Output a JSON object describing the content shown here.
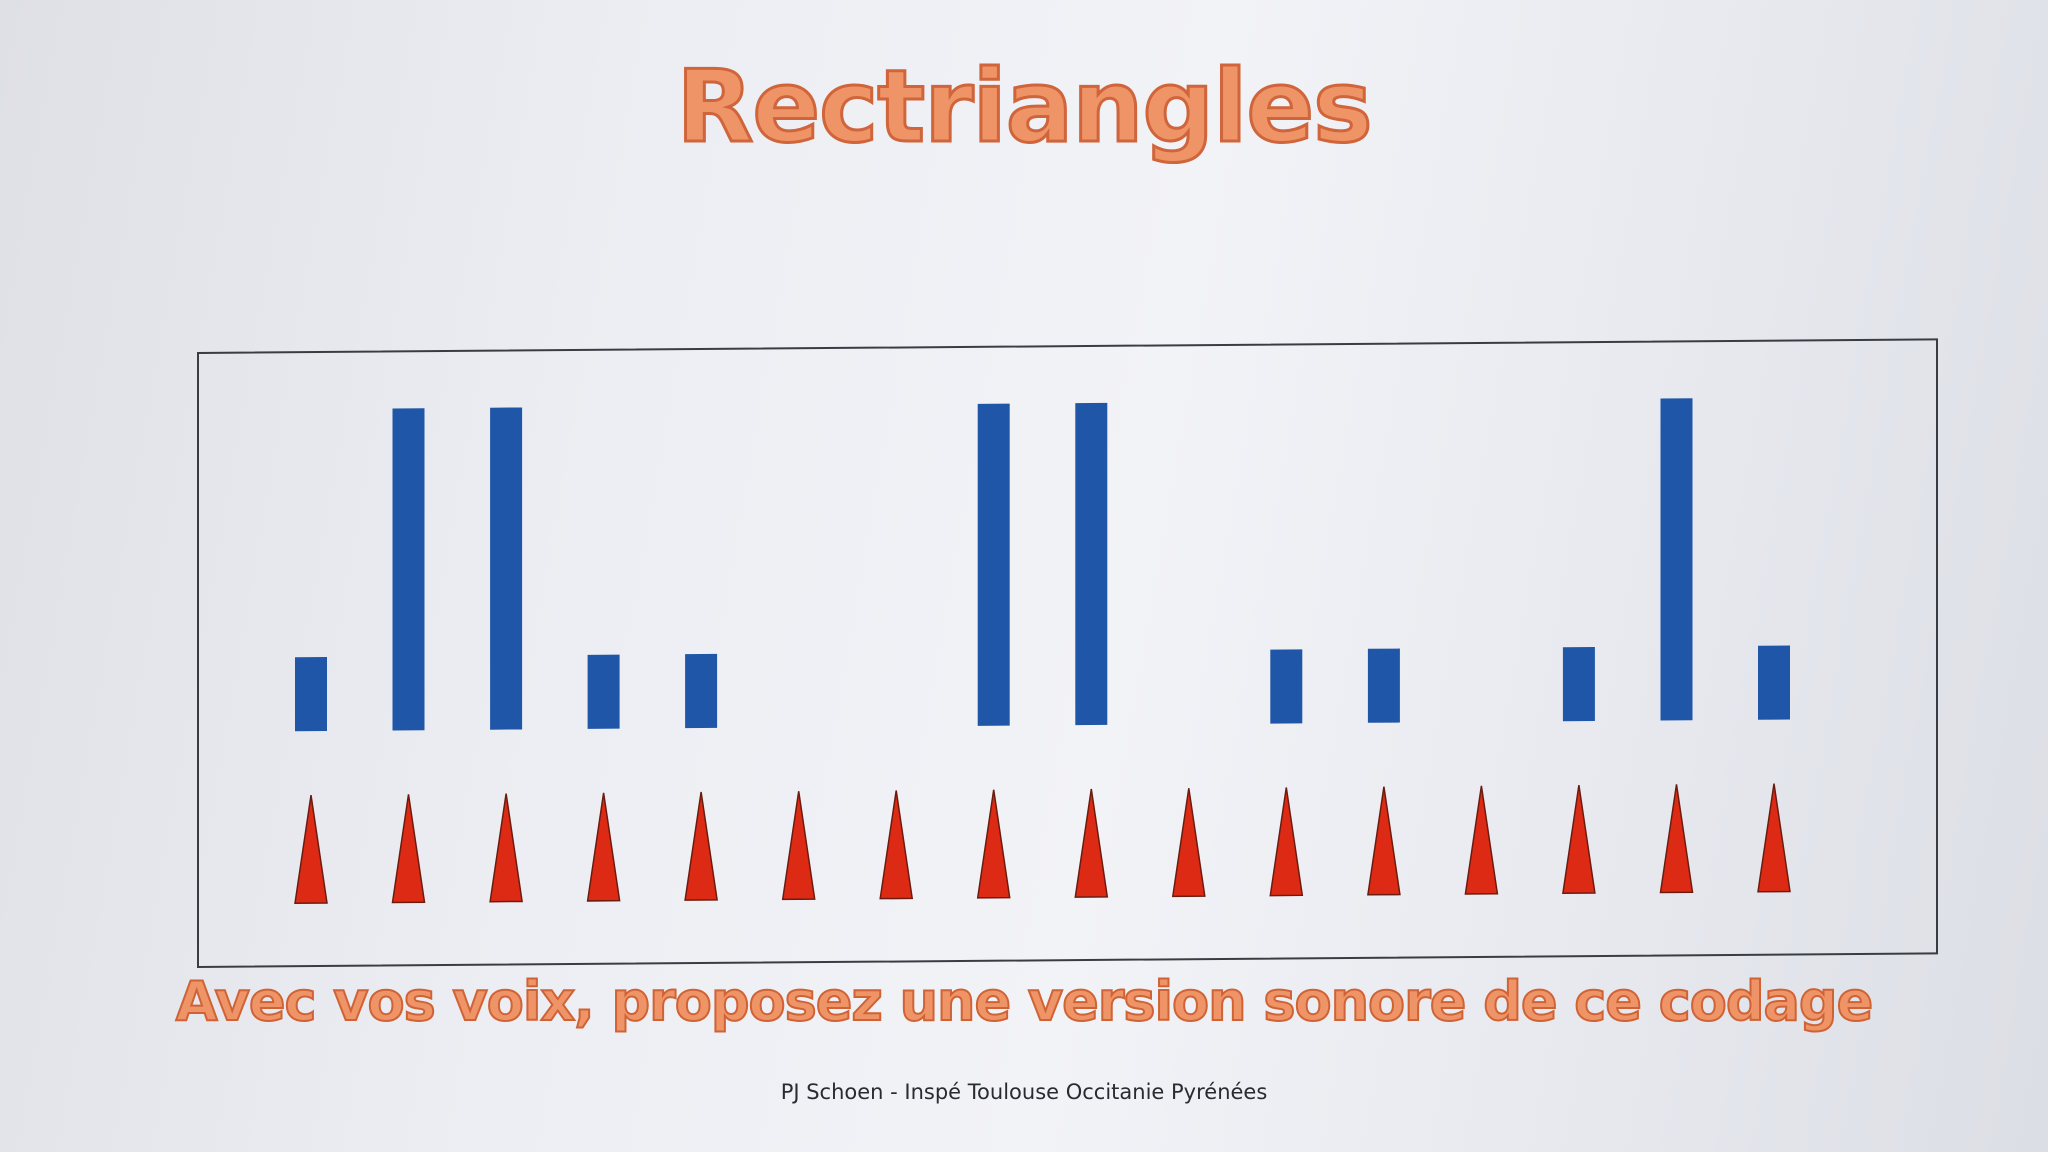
{
  "title": "Rectriangles",
  "instruction": "Avec vos voix, proposez une version sonore de ce codage",
  "credit": "PJ Schoen - Inspé Toulouse Occitanie Pyrénées",
  "colors": {
    "title": "#ef9466",
    "title_outline": "#d0643a",
    "rectangle": "#1f56a8",
    "triangle": "#dd2a14",
    "triangle_outline": "#6b1c0f"
  },
  "codage": {
    "beats": 16,
    "rectangles": [
      {
        "beat": 1,
        "size": "short"
      },
      {
        "beat": 2,
        "size": "long"
      },
      {
        "beat": 3,
        "size": "long"
      },
      {
        "beat": 4,
        "size": "short"
      },
      {
        "beat": 5,
        "size": "short"
      },
      {
        "beat": 8,
        "size": "long"
      },
      {
        "beat": 9,
        "size": "long"
      },
      {
        "beat": 11,
        "size": "short"
      },
      {
        "beat": 12,
        "size": "short"
      },
      {
        "beat": 14,
        "size": "short"
      },
      {
        "beat": 15,
        "size": "long"
      },
      {
        "beat": 16,
        "size": "short"
      }
    ]
  }
}
